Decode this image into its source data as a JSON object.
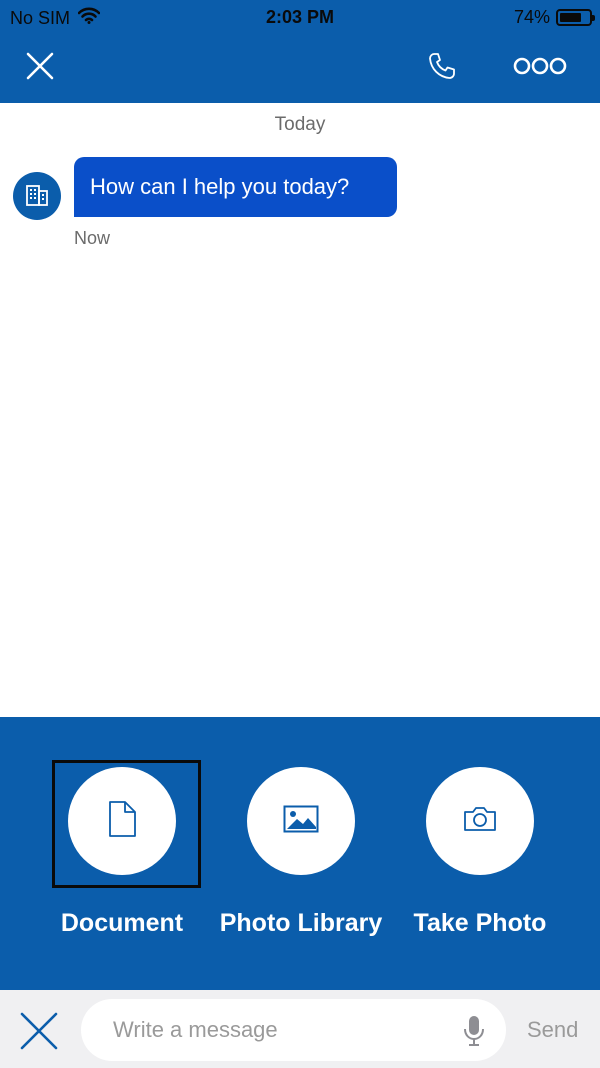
{
  "status_bar": {
    "carrier": "No SIM",
    "time": "2:03 PM",
    "battery_text": "74%",
    "battery_level": 0.74,
    "wifi_icon": "wifi-icon"
  },
  "nav": {
    "close_icon": "close-icon",
    "call_icon": "phone-icon",
    "more_icon": "more-icon"
  },
  "chat": {
    "day_label": "Today",
    "messages": [
      {
        "sender_icon": "building-icon",
        "text": "How can I help you today?",
        "time": "Now"
      }
    ]
  },
  "attach": {
    "options": [
      {
        "label": "Document",
        "icon": "document-icon",
        "selected": true
      },
      {
        "label": "Photo Library",
        "icon": "image-icon",
        "selected": false
      },
      {
        "label": "Take Photo",
        "icon": "camera-icon",
        "selected": false
      }
    ]
  },
  "composer": {
    "placeholder": "Write a message",
    "value": "",
    "send_label": "Send",
    "mic_icon": "microphone-icon",
    "close_icon": "close-icon"
  },
  "colors": {
    "brand_blue": "#0b5dab",
    "bubble_blue": "#0a4fc9",
    "composer_bg": "#f0f0f2"
  }
}
